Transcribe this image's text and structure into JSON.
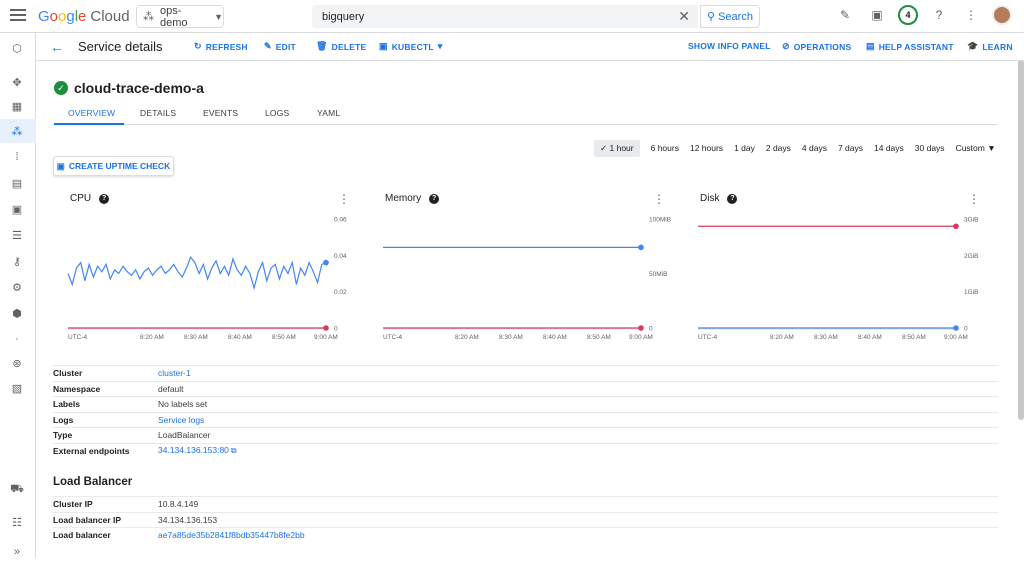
{
  "topbar": {
    "logo_text": "Google",
    "logo_product": "Cloud",
    "project": "ops-demo",
    "search_value": "bigquery",
    "search_button": "Search",
    "notification_count": "4"
  },
  "actionbar": {
    "title": "Service details",
    "refresh": "REFRESH",
    "edit": "EDIT",
    "delete": "DELETE",
    "kubectl": "KUBECTL",
    "show_info_panel": "SHOW INFO PANEL",
    "operations": "OPERATIONS",
    "help_assistant": "HELP ASSISTANT",
    "learn": "LEARN"
  },
  "service": {
    "name": "cloud-trace-demo-a",
    "status_color": "#1e8e3e"
  },
  "tabs": [
    {
      "label": "OVERVIEW",
      "active": true
    },
    {
      "label": "DETAILS",
      "active": false
    },
    {
      "label": "EVENTS",
      "active": false
    },
    {
      "label": "LOGS",
      "active": false
    },
    {
      "label": "YAML",
      "active": false
    }
  ],
  "time_ranges": [
    "1 hour",
    "6 hours",
    "12 hours",
    "1 day",
    "2 days",
    "4 days",
    "7 days",
    "14 days",
    "30 days",
    "Custom"
  ],
  "selected_time_range": "1 hour",
  "uptime_button": "CREATE UPTIME CHECK",
  "chart_data": [
    {
      "type": "line",
      "title": "CPU",
      "x_ticks": [
        "UTC-4",
        "8:20 AM",
        "8:30 AM",
        "8:40 AM",
        "8:50 AM",
        "9:00 AM"
      ],
      "y_ticks": [
        "0.06",
        "0.04",
        "0.02",
        "0"
      ],
      "ylim": [
        0,
        0.06
      ],
      "series": [
        {
          "color": "#4285f4",
          "values": [
            0.03,
            0.024,
            0.033,
            0.036,
            0.026,
            0.035,
            0.028,
            0.034,
            0.031,
            0.035,
            0.027,
            0.032,
            0.03,
            0.034,
            0.031,
            0.029,
            0.032,
            0.027,
            0.031,
            0.033,
            0.029,
            0.032,
            0.034,
            0.03,
            0.032,
            0.035,
            0.031,
            0.028,
            0.033,
            0.039,
            0.036,
            0.03,
            0.035,
            0.027,
            0.033,
            0.037,
            0.03,
            0.034,
            0.029,
            0.038,
            0.032,
            0.029,
            0.034,
            0.03,
            0.022,
            0.031,
            0.036,
            0.026,
            0.033,
            0.035,
            0.027,
            0.034,
            0.03,
            0.036,
            0.024,
            0.033,
            0.029,
            0.036,
            0.031,
            0.025,
            0.035,
            0.036
          ]
        },
        {
          "color": "#d93a5e",
          "values": [
            0,
            0
          ]
        }
      ]
    },
    {
      "type": "line",
      "title": "Memory",
      "x_ticks": [
        "UTC-4",
        "8:20 AM",
        "8:30 AM",
        "8:40 AM",
        "8:50 AM",
        "9:00 AM"
      ],
      "y_ticks": [
        "100MiB",
        "50MiB",
        "0"
      ],
      "ylim": [
        0,
        100
      ],
      "series": [
        {
          "color": "#4285f4",
          "values": [
            74,
            74
          ]
        },
        {
          "color": "#d93a5e",
          "values": [
            0,
            0
          ]
        }
      ]
    },
    {
      "type": "line",
      "title": "Disk",
      "x_ticks": [
        "UTC-4",
        "8:20 AM",
        "8:30 AM",
        "8:40 AM",
        "8:50 AM",
        "9:00 AM"
      ],
      "y_ticks": [
        "3GiB",
        "2GiB",
        "1GiB",
        "0"
      ],
      "ylim": [
        0,
        3
      ],
      "series": [
        {
          "color": "#d93a5e",
          "values": [
            2.8,
            2.8
          ]
        },
        {
          "color": "#4285f4",
          "values": [
            0,
            0
          ]
        }
      ]
    }
  ],
  "properties": [
    {
      "key": "Cluster",
      "value": "cluster-1",
      "link": true
    },
    {
      "key": "Namespace",
      "value": "default",
      "link": false
    },
    {
      "key": "Labels",
      "value": "No labels set",
      "link": false
    },
    {
      "key": "Logs",
      "value": "Service logs",
      "link": true
    },
    {
      "key": "Type",
      "value": "LoadBalancer",
      "link": false
    },
    {
      "key": "External endpoints",
      "value": "34.134.136.153:80",
      "link": true
    }
  ],
  "load_balancer": {
    "title": "Load Balancer",
    "rows": [
      {
        "key": "Cluster IP",
        "value": "10.8.4.149",
        "link": false
      },
      {
        "key": "Load balancer IP",
        "value": "34.134.136.153",
        "link": false
      },
      {
        "key": "Load balancer",
        "value": "ae7a85de35b2841f8bdb35447b8fe2bb",
        "link": true
      }
    ]
  }
}
